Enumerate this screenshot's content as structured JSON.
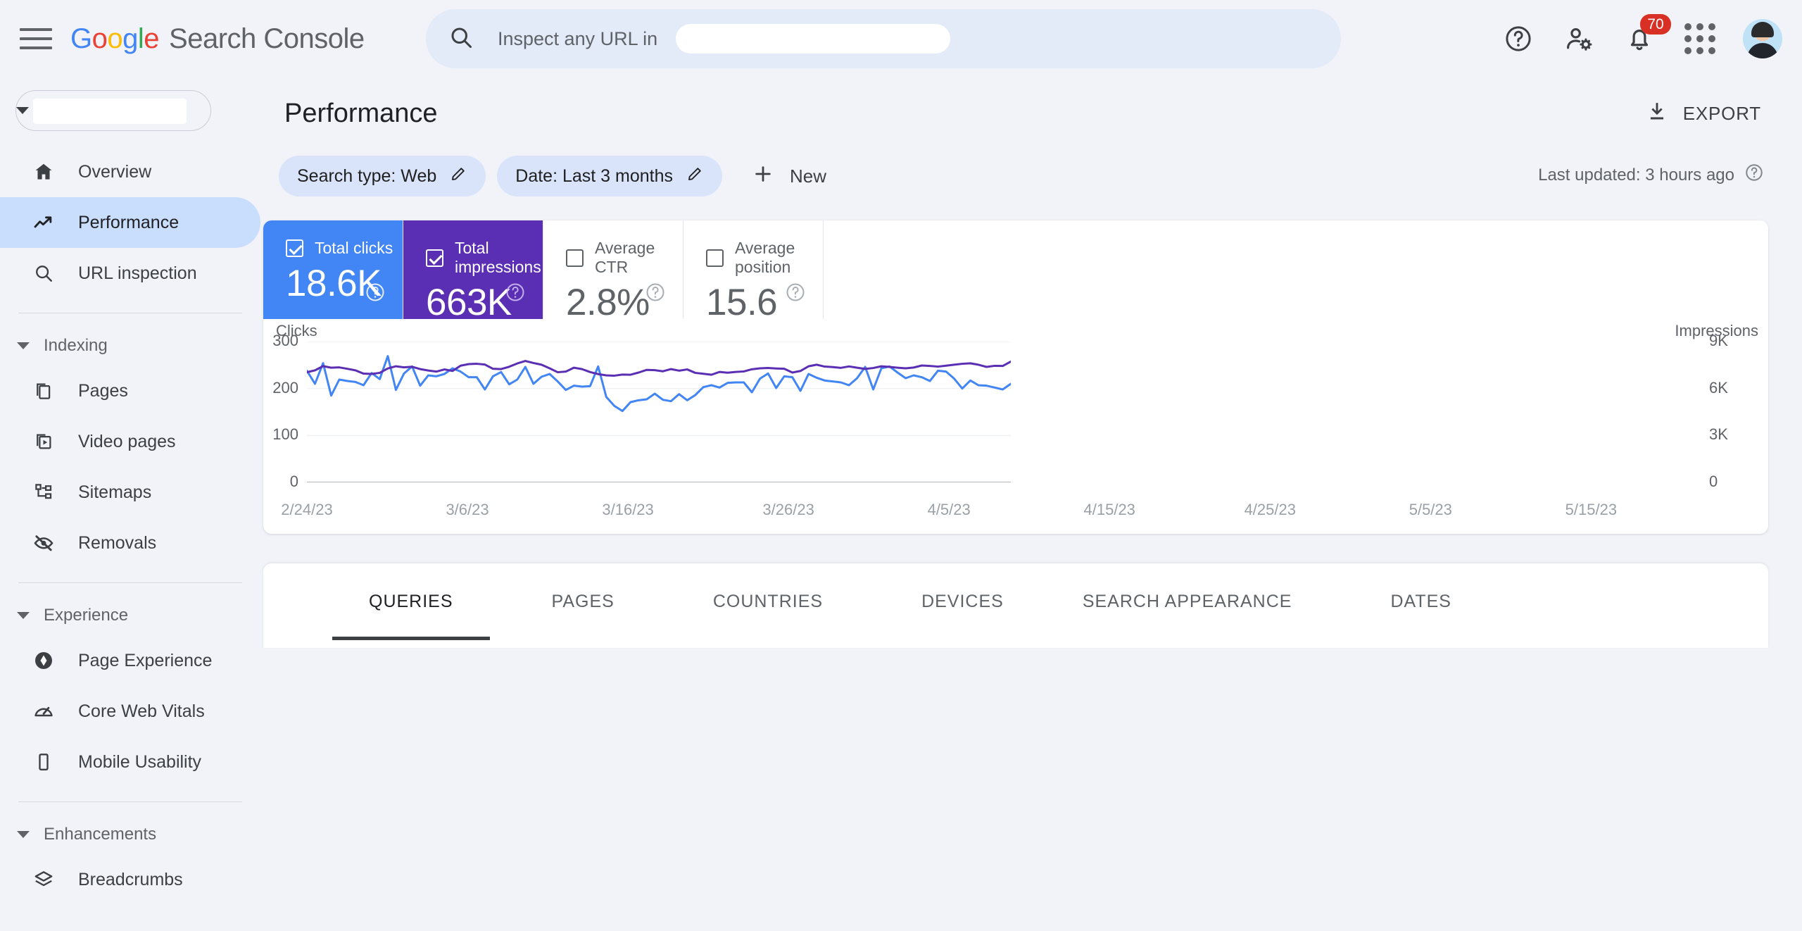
{
  "app": {
    "brand_google": [
      "G",
      "o",
      "o",
      "g",
      "l",
      "e"
    ],
    "brand_suffix": "Search Console",
    "menu_icon": "hamburger-icon"
  },
  "search": {
    "icon": "search-icon",
    "placeholder_prefix": "Inspect any URL in",
    "value": ""
  },
  "topbar_icons": {
    "help": "help-icon",
    "account_settings": "account-settings-icon",
    "notifications": "bell-icon",
    "notification_count": "70",
    "apps": "apps-grid-icon",
    "avatar": "user-avatar"
  },
  "sidebar": {
    "property_selector": {
      "value": "",
      "caret": "chevron-down-icon"
    },
    "items": [
      {
        "label": "Overview",
        "icon": "home-icon",
        "active": false
      },
      {
        "label": "Performance",
        "icon": "trending-up-icon",
        "active": true
      },
      {
        "label": "URL inspection",
        "icon": "search-icon",
        "active": false
      }
    ],
    "groups": [
      {
        "label": "Indexing",
        "items": [
          {
            "label": "Pages",
            "icon": "pages-icon"
          },
          {
            "label": "Video pages",
            "icon": "video-pages-icon"
          },
          {
            "label": "Sitemaps",
            "icon": "sitemap-icon"
          },
          {
            "label": "Removals",
            "icon": "eye-off-icon"
          }
        ]
      },
      {
        "label": "Experience",
        "items": [
          {
            "label": "Page Experience",
            "icon": "page-experience-icon"
          },
          {
            "label": "Core Web Vitals",
            "icon": "speedometer-icon"
          },
          {
            "label": "Mobile Usability",
            "icon": "mobile-icon"
          }
        ]
      },
      {
        "label": "Enhancements",
        "items": [
          {
            "label": "Breadcrumbs",
            "icon": "layers-icon"
          }
        ]
      }
    ]
  },
  "page": {
    "title": "Performance",
    "export_label": "EXPORT",
    "export_icon": "download-icon"
  },
  "filters": {
    "chips": [
      {
        "label": "Search type: Web",
        "icon": "pencil-icon"
      },
      {
        "label": "Date: Last 3 months",
        "icon": "pencil-icon"
      }
    ],
    "new_label": "New",
    "new_icon": "plus-icon",
    "last_updated": "Last updated: 3 hours ago",
    "last_updated_icon": "help-icon"
  },
  "metrics": [
    {
      "label": "Total clicks",
      "value": "18.6K",
      "checked": true,
      "color": "#4285F4",
      "help": "help-icon"
    },
    {
      "label": "Total impressions",
      "value": "663K",
      "checked": true,
      "color": "#5B2FB3",
      "help": "help-icon"
    },
    {
      "label": "Average CTR",
      "value": "2.8%",
      "checked": false,
      "color": "#ffffff",
      "help": "help-icon"
    },
    {
      "label": "Average position",
      "value": "15.6",
      "checked": false,
      "color": "#ffffff",
      "help": "help-icon"
    }
  ],
  "tabs": [
    {
      "label": "QUERIES",
      "active": true
    },
    {
      "label": "PAGES",
      "active": false
    },
    {
      "label": "COUNTRIES",
      "active": false
    },
    {
      "label": "DEVICES",
      "active": false
    },
    {
      "label": "SEARCH APPEARANCE",
      "active": false
    },
    {
      "label": "DATES",
      "active": false
    }
  ],
  "chart_data": {
    "type": "line",
    "title": "",
    "xlabel": "",
    "ylabel": "Clicks",
    "y2label": "Impressions",
    "ylim": [
      0,
      300
    ],
    "y2lim": [
      0,
      9000
    ],
    "yticks": [
      "0",
      "100",
      "200",
      "300"
    ],
    "ytick_values": [
      0,
      100,
      200,
      300
    ],
    "y2ticks": [
      "0",
      "3K",
      "6K",
      "9K"
    ],
    "y2tick_values": [
      0,
      3000,
      6000,
      9000
    ],
    "grid": true,
    "legend": "none",
    "x_start": "2/24/23",
    "x_end": "5/22/23",
    "xticks": [
      "2/24/23",
      "3/6/23",
      "3/16/23",
      "3/26/23",
      "4/5/23",
      "4/15/23",
      "4/25/23",
      "5/5/23",
      "5/15/23"
    ],
    "xtick_positions": [
      0,
      10,
      20,
      30,
      40,
      50,
      60,
      70,
      80
    ],
    "n_points": 88,
    "series": [
      {
        "name": "Clicks",
        "color": "#4285F4",
        "axis": "left",
        "values": [
          238,
          210,
          254,
          185,
          219,
          216,
          214,
          207,
          233,
          220,
          269,
          197,
          232,
          247,
          206,
          228,
          226,
          231,
          243,
          236,
          224,
          224,
          198,
          226,
          235,
          209,
          219,
          246,
          210,
          225,
          231,
          215,
          197,
          206,
          204,
          205,
          247,
          182,
          163,
          152,
          171,
          175,
          177,
          189,
          176,
          173,
          188,
          175,
          186,
          203,
          207,
          202,
          212,
          213,
          213,
          192,
          221,
          232,
          201,
          226,
          224,
          195,
          231,
          223,
          217,
          215,
          213,
          207,
          222,
          246,
          198,
          243,
          247,
          234,
          222,
          228,
          224,
          216,
          238,
          236,
          221,
          200,
          217,
          207,
          206,
          202,
          198,
          210
        ]
      },
      {
        "name": "Impressions",
        "color": "#5B2FB3",
        "axis": "right",
        "values": [
          7040,
          7160,
          7430,
          7330,
          7350,
          7260,
          7160,
          6950,
          6930,
          7000,
          7280,
          7420,
          7350,
          7390,
          7240,
          7150,
          7080,
          7220,
          7120,
          7460,
          7560,
          7580,
          7530,
          7260,
          7240,
          7390,
          7600,
          7760,
          7630,
          7520,
          7290,
          7040,
          7080,
          7330,
          7240,
          7050,
          6920,
          6840,
          6820,
          6890,
          6880,
          7020,
          7190,
          7170,
          7100,
          7240,
          7140,
          7220,
          7000,
          6940,
          6880,
          7060,
          7010,
          7060,
          7090,
          7230,
          7290,
          7310,
          7280,
          7260,
          7020,
          7120,
          7420,
          7520,
          7400,
          7370,
          7320,
          7410,
          7330,
          7250,
          7310,
          7420,
          7380,
          7330,
          7290,
          7340,
          7470,
          7440,
          7400,
          7460,
          7520,
          7580,
          7610,
          7520,
          7380,
          7450,
          7440,
          7720
        ]
      }
    ]
  }
}
